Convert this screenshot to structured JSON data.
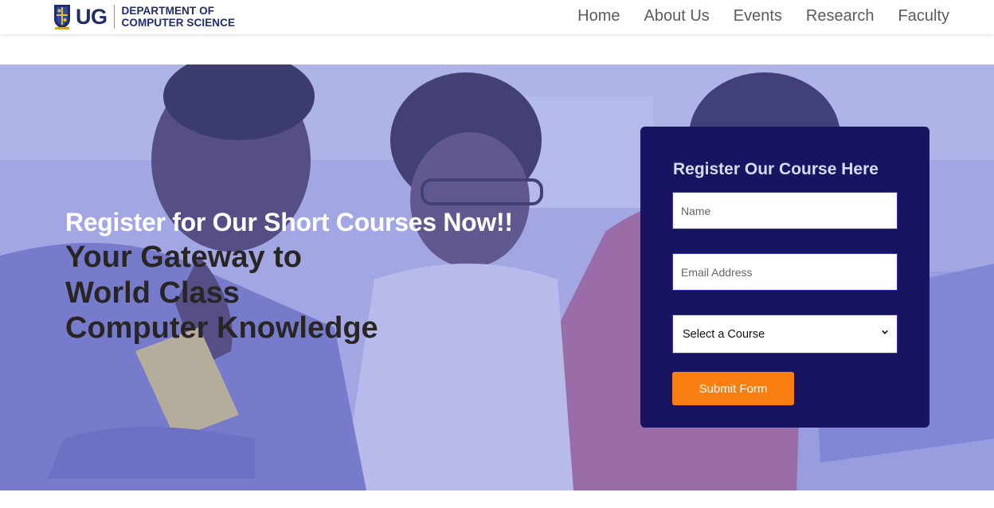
{
  "header": {
    "logo": {
      "abbr": "UG",
      "line1": "DEPARTMENT OF",
      "line2": "COMPUTER SCIENCE",
      "icon": "university-crest-icon"
    },
    "nav": [
      {
        "label": "Home"
      },
      {
        "label": "About Us"
      },
      {
        "label": "Events"
      },
      {
        "label": "Research"
      },
      {
        "label": "Faculty"
      }
    ]
  },
  "hero": {
    "kicker": "Register for Our Short Courses Now!!",
    "title_lines": [
      "Your Gateway to",
      "World Class",
      "Computer Knowledge"
    ],
    "image": "students-at-laptops-photo"
  },
  "form": {
    "title": "Register Our Course Here",
    "name_placeholder": "Name",
    "email_placeholder": "Email Address",
    "course_selected": "Select a Course",
    "submit_label": "Submit Form"
  },
  "colors": {
    "brand_navy": "#1f2d6b",
    "form_bg": "#181461",
    "submit_orange": "#f97f13",
    "hero_overlay": "#6870d6"
  }
}
